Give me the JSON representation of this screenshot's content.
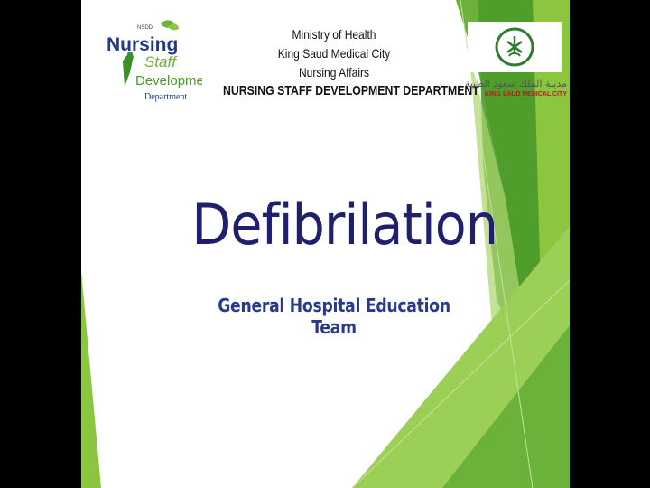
{
  "header": {
    "ministry": "Ministry of Health",
    "city": "King Saud Medical City",
    "affairs": "Nursing Affairs",
    "department": "NURSING STAFF DEVELOPMENT DEPARTMENT"
  },
  "nsdd_logo": {
    "tag": "NSDD",
    "word1": "Nursing",
    "word2": "Staff",
    "word3": "Developmen",
    "word4": "Department"
  },
  "ksmc_logo": {
    "arabic": "مدينة الملك سعود الطبية",
    "english": "KING SAUD MEDICAL CITY"
  },
  "title": "Defibrilation",
  "subtitle": "General Hospital Education Team",
  "colors": {
    "title": "#1f1f6e",
    "subtitle": "#283a8c",
    "green_dark": "#4c9a2a",
    "green_light": "#8cc63f",
    "green_pale": "#c6e29b"
  }
}
